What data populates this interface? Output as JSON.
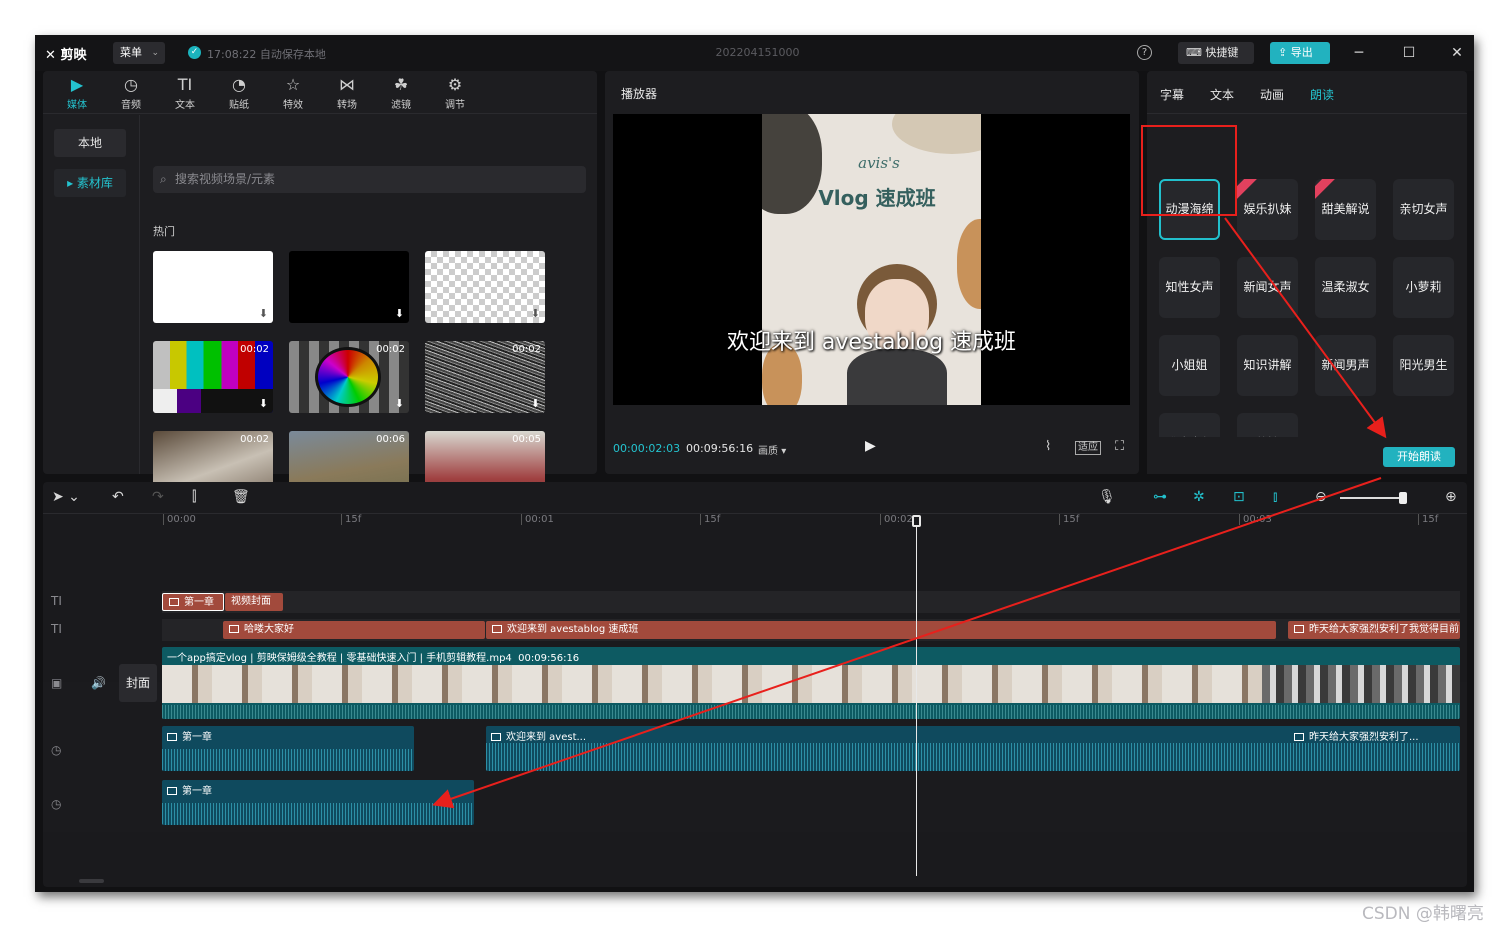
{
  "titlebar": {
    "logo": "剪映",
    "menu_label": "菜单",
    "autosave_text": "17:08:22 自动保存本地",
    "project_name": "202204151000",
    "help_label": "?",
    "shortcut_label": "快捷键",
    "export_label": "导出",
    "minimize": "─",
    "maximize": "☐",
    "close": "✕"
  },
  "toolbar": {
    "tabs": [
      {
        "label": "媒体",
        "icon": "media-icon"
      },
      {
        "label": "音频",
        "icon": "audio-icon"
      },
      {
        "label": "文本",
        "icon": "text-icon"
      },
      {
        "label": "贴纸",
        "icon": "sticker-icon"
      },
      {
        "label": "特效",
        "icon": "effects-icon"
      },
      {
        "label": "转场",
        "icon": "transition-icon"
      },
      {
        "label": "滤镜",
        "icon": "filter-icon"
      },
      {
        "label": "调节",
        "icon": "adjust-icon"
      }
    ],
    "active_tab": "媒体"
  },
  "media": {
    "local_label": "本地",
    "library_label": "素材库",
    "search_placeholder": "搜索视频场景/元素",
    "section_label": "热门",
    "items": [
      {
        "kind": "white",
        "duration": ""
      },
      {
        "kind": "black",
        "duration": ""
      },
      {
        "kind": "transparent",
        "duration": ""
      },
      {
        "kind": "color-bars",
        "duration": "00:02"
      },
      {
        "kind": "test-card",
        "duration": "00:02"
      },
      {
        "kind": "static-noise",
        "duration": "00:02"
      },
      {
        "kind": "bird-clip",
        "duration": "00:02"
      },
      {
        "kind": "animal-clip",
        "duration": "00:06"
      },
      {
        "kind": "car-clip",
        "duration": "00:05"
      }
    ]
  },
  "player": {
    "title": "播放器",
    "video_title_line1": "avis's",
    "video_title_line2": "Vlog 速成班",
    "subtitle": "欢迎来到 avestablog 速成班",
    "current_time": "00:00:02:03",
    "total_time": "00:09:56:16",
    "quality_label": "画质",
    "fit_label": "适应"
  },
  "right_panel": {
    "tabs": [
      "字幕",
      "文本",
      "动画",
      "朗读"
    ],
    "active_tab": "朗读",
    "voices": [
      {
        "label": "动漫海绵",
        "selected": true,
        "vip": false
      },
      {
        "label": "娱乐扒妹",
        "selected": false,
        "vip": true
      },
      {
        "label": "甜美解说",
        "selected": false,
        "vip": true
      },
      {
        "label": "亲切女声",
        "selected": false,
        "vip": false
      },
      {
        "label": "知性女声",
        "selected": false,
        "vip": false
      },
      {
        "label": "新闻女声",
        "selected": false,
        "vip": false
      },
      {
        "label": "温柔淑女",
        "selected": false,
        "vip": false
      },
      {
        "label": "小萝莉",
        "selected": false,
        "vip": false
      },
      {
        "label": "小姐姐",
        "selected": false,
        "vip": false
      },
      {
        "label": "知识讲解",
        "selected": false,
        "vip": false
      },
      {
        "label": "新闻男声",
        "selected": false,
        "vip": false
      },
      {
        "label": "阳光男生",
        "selected": false,
        "vip": false
      },
      {
        "label": "雅痞大叔",
        "selected": false,
        "vip": false
      },
      {
        "label": "萌娃",
        "selected": false,
        "vip": false
      }
    ],
    "start_button": "开始朗读"
  },
  "timeline": {
    "ruler": [
      "00:00",
      "15f",
      "00:01",
      "15f",
      "00:02",
      "15f",
      "00:03",
      "15f"
    ],
    "cover_label": "封面",
    "text_track_1": [
      {
        "label": "第一章"
      },
      {
        "label": "视频封面"
      }
    ],
    "text_track_2": [
      {
        "label": "哈喽大家好"
      },
      {
        "label": "欢迎来到 avestablog 速成班"
      },
      {
        "label": "昨天给大家强烈安利了我觉得目前"
      }
    ],
    "video_clip": {
      "title": "一个app搞定vlog | 剪映保姆级全教程 | 零基础快速入门 | 手机剪辑教程.mp4",
      "duration": "00:09:56:16"
    },
    "audio_track_1": [
      {
        "label": "第一章"
      },
      {
        "label": "欢迎来到 avest..."
      },
      {
        "label": "昨天给大家强烈安利了..."
      }
    ],
    "audio_track_2": [
      {
        "label": "第一章"
      }
    ]
  },
  "watermark": "CSDN @韩曙亮",
  "colors": {
    "accent": "#22b2bf",
    "text_clip": "#a24a3c",
    "video_clip": "#0d5a62",
    "audio_clip": "#0f4a5e",
    "annotation_red": "#e8201c"
  }
}
